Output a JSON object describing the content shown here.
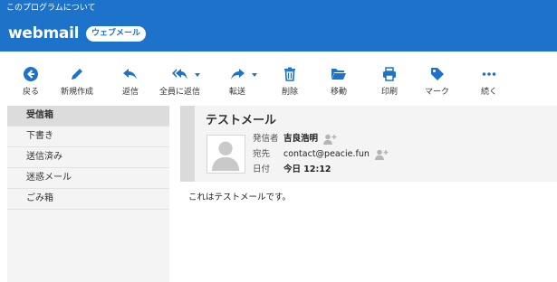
{
  "header": {
    "about_link": "このプログラムについて",
    "logo": "webmail",
    "badge": "ウェブメール"
  },
  "toolbar": {
    "back": "戻る",
    "compose": "新規作成",
    "reply": "返信",
    "reply_all": "全員に返信",
    "forward": "転送",
    "delete": "削除",
    "move": "移動",
    "print": "印刷",
    "mark": "マーク",
    "more": "続く"
  },
  "folders": [
    "受信箱",
    "下書き",
    "送信済み",
    "迷惑メール",
    "ごみ箱"
  ],
  "message": {
    "subject": "テストメール",
    "from_label": "発信者",
    "from": "吉良浩明",
    "to_label": "宛先",
    "to": "contact@peacie.fun",
    "date_label": "日付",
    "date": "今日 12:12",
    "body": "これはテストメールです。"
  },
  "colors": {
    "accent": "#1d73c9",
    "sidebar_bg": "#f4f4f4",
    "selected_bg": "#dcdcdc"
  }
}
